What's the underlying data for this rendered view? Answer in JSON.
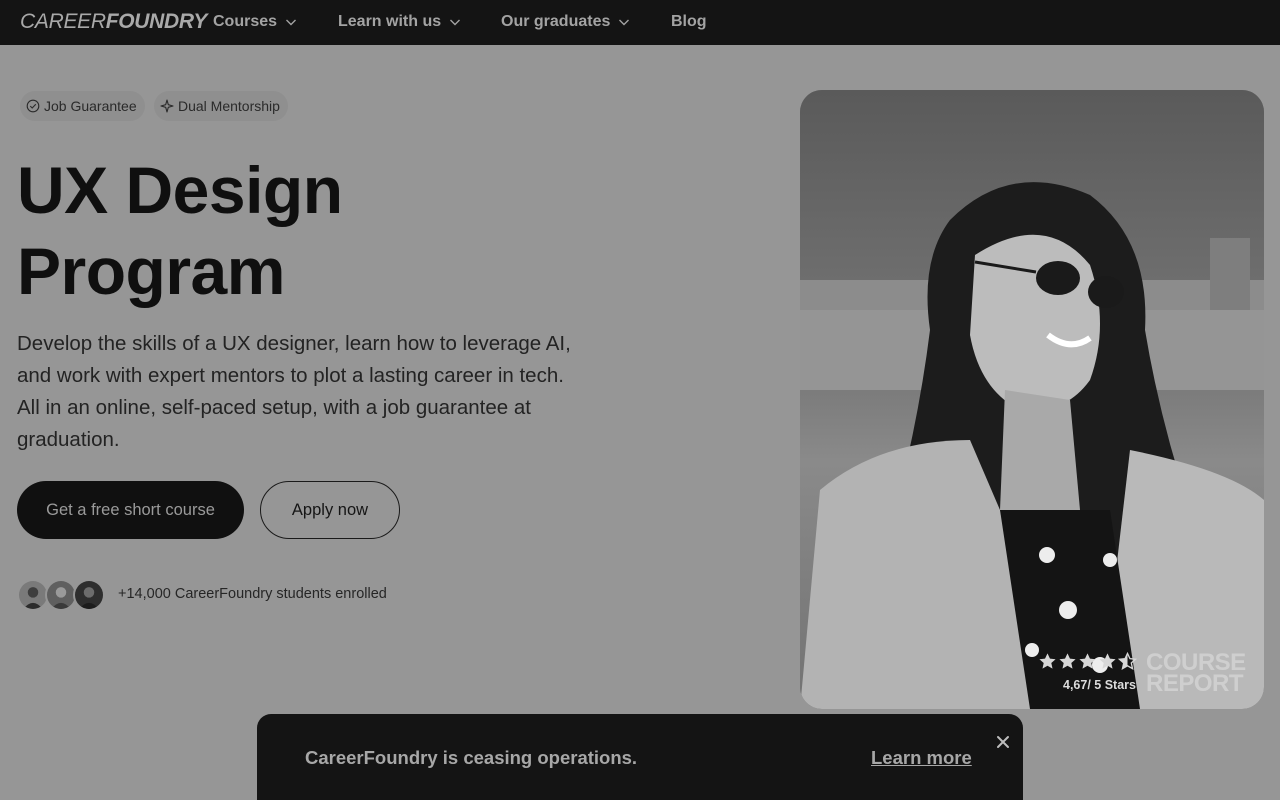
{
  "nav": {
    "logo_thin": "CAREER",
    "logo_bold": "FOUNDRY",
    "items": [
      {
        "label": "Courses",
        "has_dropdown": true,
        "icon": "chevron-down-icon"
      },
      {
        "label": "Learn with us",
        "has_dropdown": true,
        "icon": "chevron-down-icon"
      },
      {
        "label": "Our graduates",
        "has_dropdown": true,
        "icon": "chevron-down-icon"
      },
      {
        "label": "Blog",
        "has_dropdown": false
      }
    ]
  },
  "tags": [
    {
      "label": "Job Guarantee",
      "icon": "badge-check-icon"
    },
    {
      "label": "Dual Mentorship",
      "icon": "sparkle-icon"
    }
  ],
  "hero": {
    "title_line1": "UX Design",
    "title_line2": "Program",
    "description": "Develop the skills of a UX designer, learn how to leverage AI, and work with expert mentors to plot a lasting career in tech. All in an online, self-paced setup, with a job guarantee at graduation.",
    "primary_cta": "Get a free short course",
    "secondary_cta": "Apply now",
    "enrolled_text": "+14,000 CareerFoundry students enrolled"
  },
  "rating": {
    "stars": 4.67,
    "text": "4,67/ 5 Stars",
    "logo_line1": "COURSE",
    "logo_line2": "REPORT"
  },
  "banner": {
    "message": "CareerFoundry is ceasing operations.",
    "link": "Learn more",
    "close_icon": "close-icon"
  },
  "colors": {
    "nav_bg": "#141414",
    "page_bg": "#969696",
    "primary_btn_bg": "#101010",
    "banner_bg": "#141414"
  }
}
